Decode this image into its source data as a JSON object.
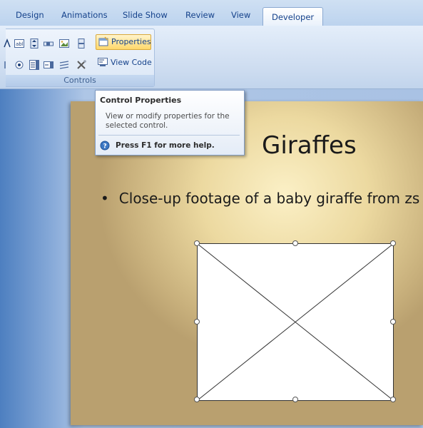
{
  "tabs": [
    {
      "label": "Design"
    },
    {
      "label": "Animations"
    },
    {
      "label": "Slide Show"
    },
    {
      "label": "Review"
    },
    {
      "label": "View"
    },
    {
      "label": "Developer"
    }
  ],
  "ribbon": {
    "group_label": "Controls",
    "properties_label": "Properties",
    "view_code_label": "View Code"
  },
  "tooltip": {
    "title": "Control Properties",
    "description": "View or modify properties for the selected control.",
    "help": "Press F1 for more help."
  },
  "slide": {
    "title": "Giraffes",
    "bullet": "Close-up footage of a baby giraffe from zs"
  },
  "colors": {
    "ribbon_text": "#15428b",
    "active_button": "#ffd86b"
  },
  "icons": [
    "label-icon",
    "textbox-icon",
    "spin-icon",
    "scrollbar-icon",
    "image-icon",
    "more-controls-icon",
    "option-icon",
    "combo-icon",
    "list-icon",
    "toggle-icon",
    "tools-icon",
    "properties-icon",
    "view-code-icon",
    "help-icon"
  ]
}
